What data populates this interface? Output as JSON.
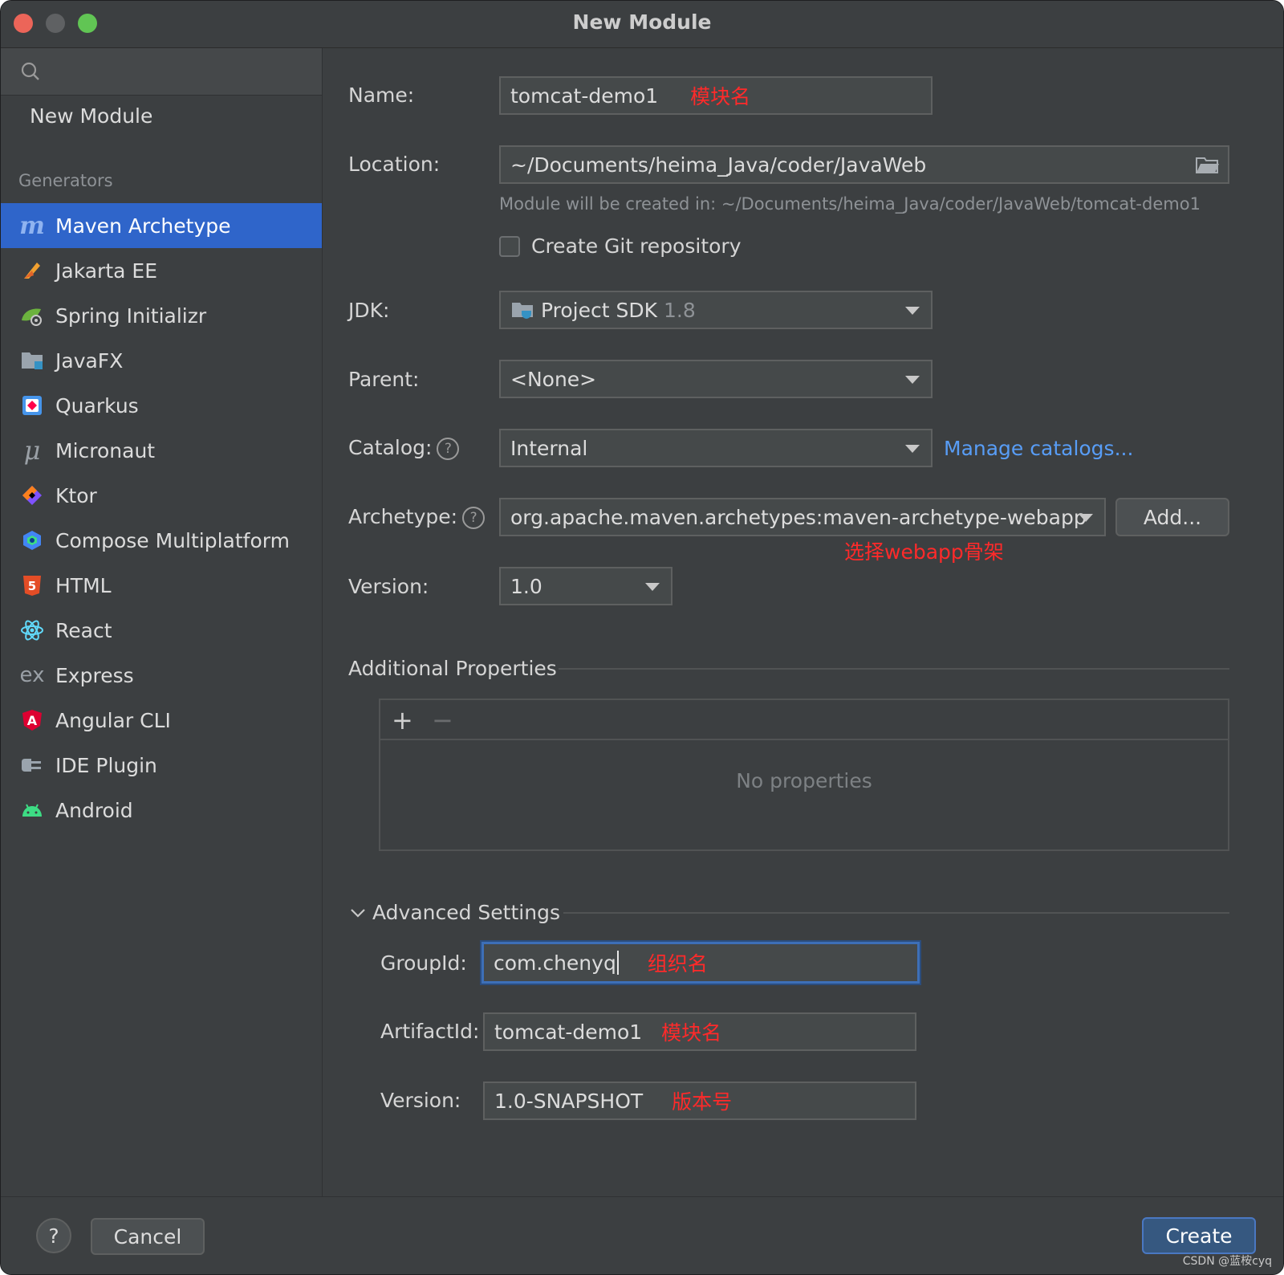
{
  "window": {
    "title": "New Module"
  },
  "sidebar": {
    "new_module": "New Module",
    "generators_label": "Generators",
    "items": [
      {
        "label": "Maven Archetype",
        "icon": "maven-icon",
        "selected": true
      },
      {
        "label": "Jakarta EE",
        "icon": "jakarta-ee-icon"
      },
      {
        "label": "Spring Initializr",
        "icon": "spring-icon"
      },
      {
        "label": "JavaFX",
        "icon": "javafx-folder-icon"
      },
      {
        "label": "Quarkus",
        "icon": "quarkus-icon"
      },
      {
        "label": "Micronaut",
        "icon": "micronaut-icon"
      },
      {
        "label": "Ktor",
        "icon": "ktor-icon"
      },
      {
        "label": "Compose Multiplatform",
        "icon": "compose-icon"
      },
      {
        "label": "HTML",
        "icon": "html5-icon"
      },
      {
        "label": "React",
        "icon": "react-icon"
      },
      {
        "label": "Express",
        "icon": "express-icon"
      },
      {
        "label": "Angular CLI",
        "icon": "angular-icon"
      },
      {
        "label": "IDE Plugin",
        "icon": "plugin-icon"
      },
      {
        "label": "Android",
        "icon": "android-icon"
      }
    ]
  },
  "form": {
    "name": {
      "label": "Name:",
      "value": "tomcat-demo1",
      "annotation": "模块名"
    },
    "location": {
      "label": "Location:",
      "value": "~/Documents/heima_Java/coder/JavaWeb",
      "hint": "Module will be created in: ~/Documents/heima_Java/coder/JavaWeb/tomcat-demo1"
    },
    "git": {
      "label": "Create Git repository",
      "checked": false
    },
    "jdk": {
      "label": "JDK:",
      "value": "Project SDK",
      "version": "1.8"
    },
    "parent": {
      "label": "Parent:",
      "value": "<None>"
    },
    "catalog": {
      "label": "Catalog:",
      "value": "Internal",
      "link": "Manage catalogs..."
    },
    "archetype": {
      "label": "Archetype:",
      "value": "org.apache.maven.archetypes:maven-archetype-webapp",
      "add_button": "Add...",
      "annotation": "选择webapp骨架"
    },
    "version": {
      "label": "Version:",
      "value": "1.0"
    },
    "additional_properties": {
      "title": "Additional Properties",
      "add": "+",
      "remove": "−",
      "empty": "No properties"
    },
    "advanced": {
      "title": "Advanced Settings",
      "groupid": {
        "label": "GroupId:",
        "value": "com.chenyq",
        "annotation": "组织名"
      },
      "artifactid": {
        "label": "ArtifactId:",
        "value": "tomcat-demo1",
        "annotation": "模块名"
      },
      "version": {
        "label": "Version:",
        "value": "1.0-SNAPSHOT",
        "annotation": "版本号"
      }
    }
  },
  "footer": {
    "help": "?",
    "cancel": "Cancel",
    "create": "Create",
    "watermark": "CSDN @蓝桉cyq"
  },
  "colors": {
    "accent": "#2f65ca",
    "link": "#589df6",
    "annotation": "#ff2a2a",
    "background": "#3c3f41"
  }
}
